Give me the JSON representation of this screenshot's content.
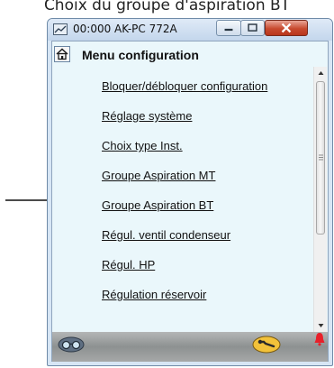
{
  "caption": {
    "text": "Choix du groupe d'aspiration BT"
  },
  "window": {
    "title": "00:000 AK-PC 772A",
    "icons": [
      "app-icon",
      "minimize-icon",
      "maximize-icon",
      "close-icon"
    ]
  },
  "header": {
    "title": "Menu configuration",
    "icon": "home-icon"
  },
  "menu": {
    "items": [
      {
        "label": "Bloquer/débloquer configuration"
      },
      {
        "label": "Réglage système"
      },
      {
        "label": "Choix type Inst."
      },
      {
        "label": "Groupe Aspiration MT"
      },
      {
        "label": "Groupe Aspiration BT"
      },
      {
        "label": "Régul. ventil condenseur"
      },
      {
        "label": "Régul. HP"
      },
      {
        "label": "Régulation réservoir"
      }
    ],
    "highlighted_item": "Groupe Aspiration BT"
  },
  "footer": {
    "icons": [
      "glasses-icon",
      "wrench-icon",
      "bell-icon"
    ]
  },
  "colors": {
    "client_background": "#eaf7fb",
    "window_frame": "#d7e6f5",
    "close_button": "#c84a2f",
    "bell_alarm": "#e8202a",
    "wrench_button": "#f2c23a"
  }
}
